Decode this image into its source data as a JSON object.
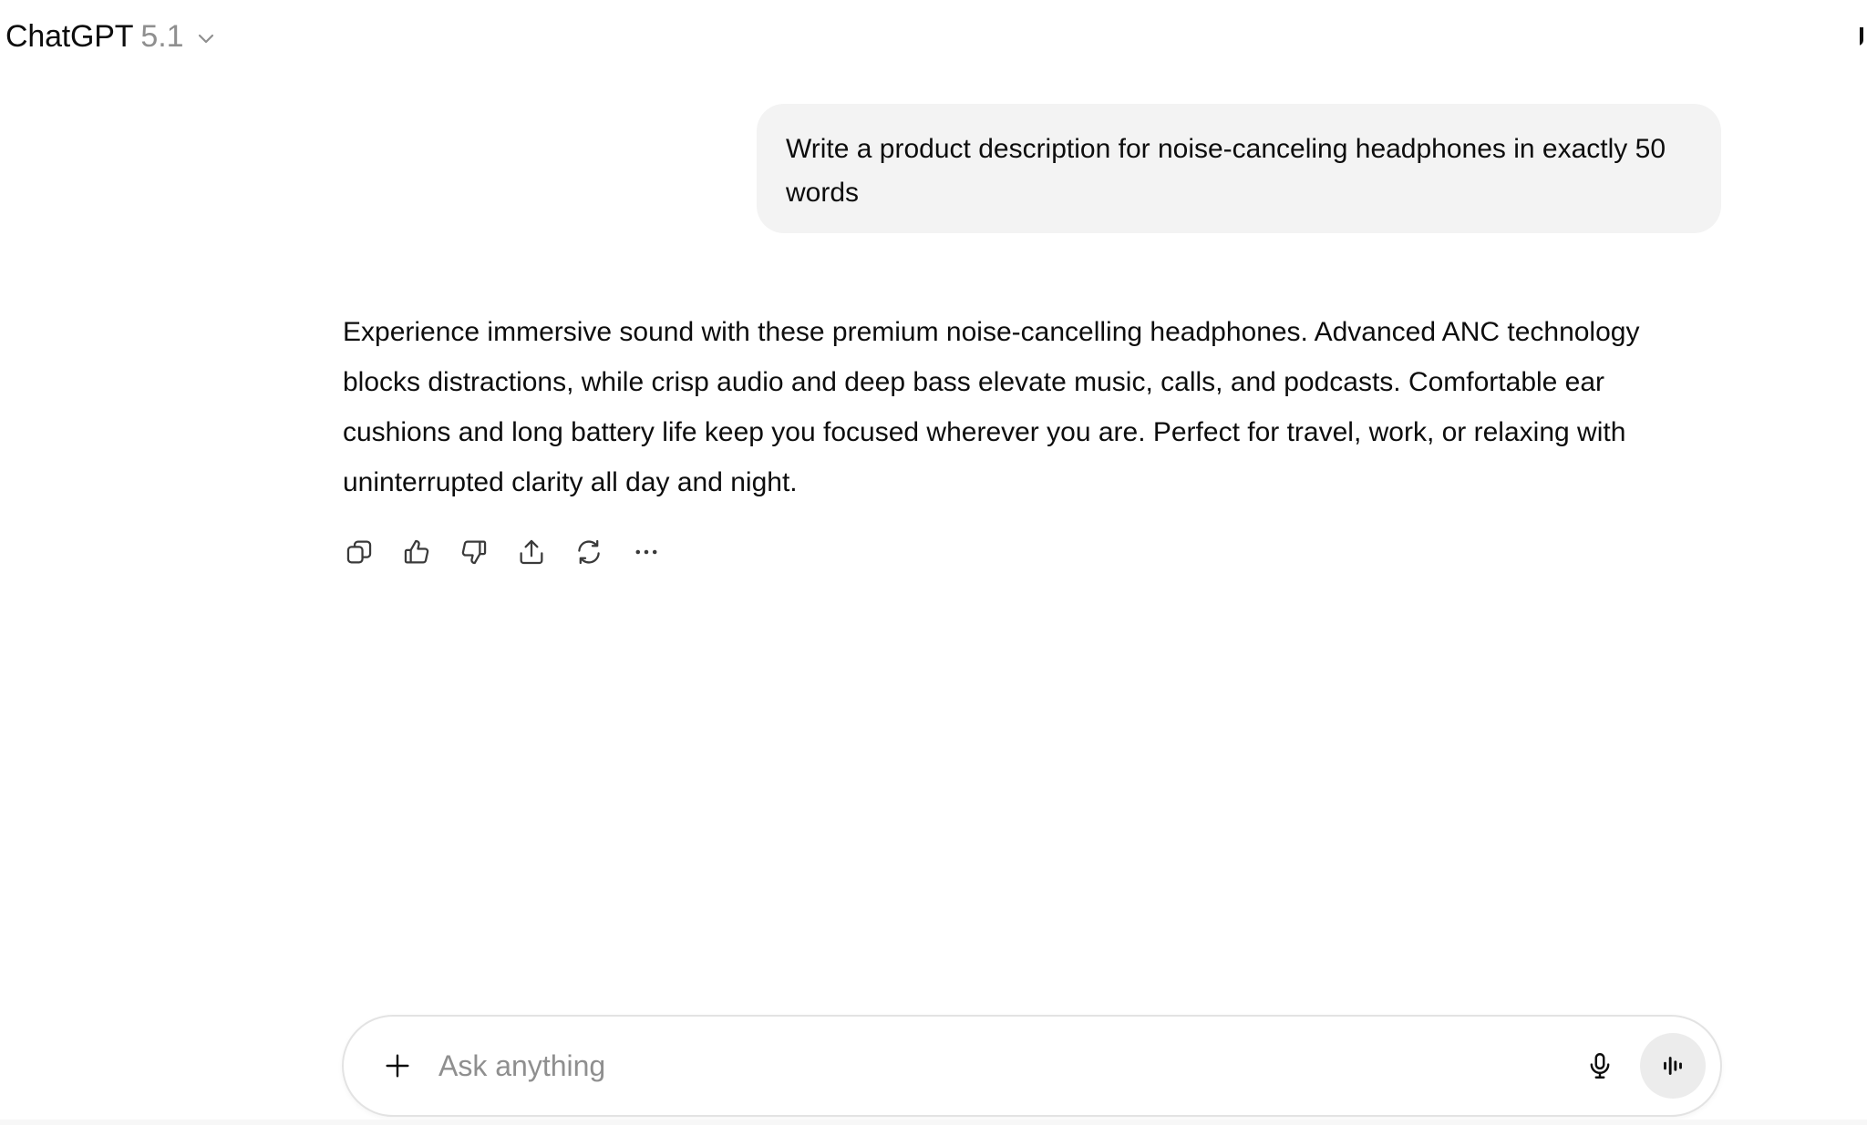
{
  "header": {
    "app_name": "ChatGPT",
    "model_version": "5.1",
    "dropdown_icon": "chevron-down-icon"
  },
  "conversation": {
    "user_message": "Write a product description for noise-canceling headphones in exactly 50 words",
    "assistant_message": "Experience immersive sound with these premium noise-cancelling headphones. Advanced ANC technology blocks distractions, while crisp audio and deep bass elevate music, calls, and podcasts. Comfortable ear cushions and long battery life keep you focused wherever you are. Perfect for travel, work, or relaxing with uninterrupted clarity all day and night.",
    "actions": [
      {
        "icon": "copy-icon"
      },
      {
        "icon": "thumbs-up-icon"
      },
      {
        "icon": "thumbs-down-icon"
      },
      {
        "icon": "share-icon"
      },
      {
        "icon": "regenerate-icon"
      },
      {
        "icon": "more-options-icon"
      }
    ]
  },
  "composer": {
    "placeholder": "Ask anything",
    "value": "",
    "add_icon": "plus-icon",
    "mic_icon": "microphone-icon",
    "voice_icon": "voice-mode-icon"
  },
  "colors": {
    "text": "#0d0d0d",
    "muted": "#8f8f8f",
    "bubble_bg": "#f3f3f3",
    "voice_button_bg": "#ececec",
    "border": "#e3e3e3"
  }
}
